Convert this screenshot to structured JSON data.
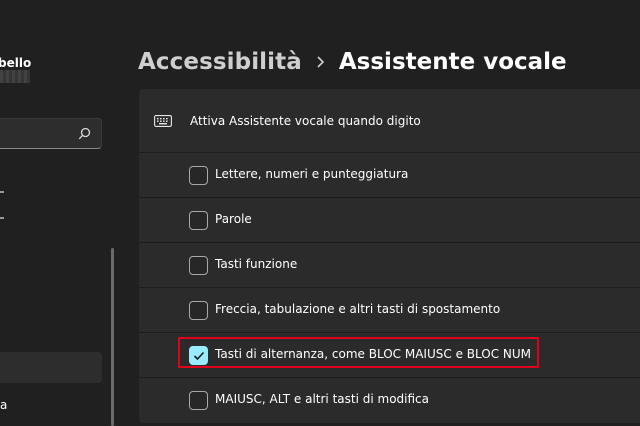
{
  "sidebar": {
    "user_name": "bello",
    "selected_label": "a"
  },
  "breadcrumb": {
    "parent": "Accessibilità",
    "current": "Assistente vocale"
  },
  "panel": {
    "header_label": "Attiva Assistente vocale quando digito",
    "options": [
      {
        "label": "Lettere, numeri e punteggiatura",
        "checked": false
      },
      {
        "label": "Parole",
        "checked": false
      },
      {
        "label": "Tasti funzione",
        "checked": false
      },
      {
        "label": "Freccia, tabulazione e altri tasti di spostamento",
        "checked": false
      },
      {
        "label": "Tasti di alternanza, come BLOC MAIUSC e BLOC NUM",
        "checked": true
      },
      {
        "label": "MAIUSC, ALT e altri tasti di modifica",
        "checked": false
      }
    ]
  },
  "colors": {
    "accent": "#99ebff",
    "highlight": "#e0001b"
  }
}
